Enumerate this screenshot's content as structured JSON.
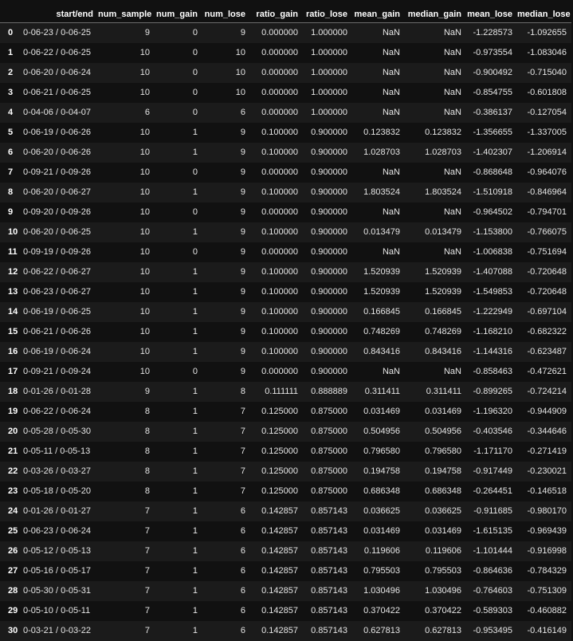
{
  "table": {
    "columns": [
      "",
      "start/end",
      "num_sample",
      "num_gain",
      "num_lose",
      "ratio_gain",
      "ratio_lose",
      "mean_gain",
      "median_gain",
      "mean_lose",
      "median_lose"
    ],
    "rows": [
      [
        "0",
        "0-06-23 / 0-06-25",
        "9",
        "0",
        "9",
        "0.000000",
        "1.000000",
        "NaN",
        "NaN",
        "-1.228573",
        "-1.092655"
      ],
      [
        "1",
        "0-06-22 / 0-06-25",
        "10",
        "0",
        "10",
        "0.000000",
        "1.000000",
        "NaN",
        "NaN",
        "-0.973554",
        "-1.083046"
      ],
      [
        "2",
        "0-06-20 / 0-06-24",
        "10",
        "0",
        "10",
        "0.000000",
        "1.000000",
        "NaN",
        "NaN",
        "-0.900492",
        "-0.715040"
      ],
      [
        "3",
        "0-06-21 / 0-06-25",
        "10",
        "0",
        "10",
        "0.000000",
        "1.000000",
        "NaN",
        "NaN",
        "-0.854755",
        "-0.601808"
      ],
      [
        "4",
        "0-04-06 / 0-04-07",
        "6",
        "0",
        "6",
        "0.000000",
        "1.000000",
        "NaN",
        "NaN",
        "-0.386137",
        "-0.127054"
      ],
      [
        "5",
        "0-06-19 / 0-06-26",
        "10",
        "1",
        "9",
        "0.100000",
        "0.900000",
        "0.123832",
        "0.123832",
        "-1.356655",
        "-1.337005"
      ],
      [
        "6",
        "0-06-20 / 0-06-26",
        "10",
        "1",
        "9",
        "0.100000",
        "0.900000",
        "1.028703",
        "1.028703",
        "-1.402307",
        "-1.206914"
      ],
      [
        "7",
        "0-09-21 / 0-09-26",
        "10",
        "0",
        "9",
        "0.000000",
        "0.900000",
        "NaN",
        "NaN",
        "-0.868648",
        "-0.964076"
      ],
      [
        "8",
        "0-06-20 / 0-06-27",
        "10",
        "1",
        "9",
        "0.100000",
        "0.900000",
        "1.803524",
        "1.803524",
        "-1.510918",
        "-0.846964"
      ],
      [
        "9",
        "0-09-20 / 0-09-26",
        "10",
        "0",
        "9",
        "0.000000",
        "0.900000",
        "NaN",
        "NaN",
        "-0.964502",
        "-0.794701"
      ],
      [
        "10",
        "0-06-20 / 0-06-25",
        "10",
        "1",
        "9",
        "0.100000",
        "0.900000",
        "0.013479",
        "0.013479",
        "-1.153800",
        "-0.766075"
      ],
      [
        "11",
        "0-09-19 / 0-09-26",
        "10",
        "0",
        "9",
        "0.000000",
        "0.900000",
        "NaN",
        "NaN",
        "-1.006838",
        "-0.751694"
      ],
      [
        "12",
        "0-06-22 / 0-06-27",
        "10",
        "1",
        "9",
        "0.100000",
        "0.900000",
        "1.520939",
        "1.520939",
        "-1.407088",
        "-0.720648"
      ],
      [
        "13",
        "0-06-23 / 0-06-27",
        "10",
        "1",
        "9",
        "0.100000",
        "0.900000",
        "1.520939",
        "1.520939",
        "-1.549853",
        "-0.720648"
      ],
      [
        "14",
        "0-06-19 / 0-06-25",
        "10",
        "1",
        "9",
        "0.100000",
        "0.900000",
        "0.166845",
        "0.166845",
        "-1.222949",
        "-0.697104"
      ],
      [
        "15",
        "0-06-21 / 0-06-26",
        "10",
        "1",
        "9",
        "0.100000",
        "0.900000",
        "0.748269",
        "0.748269",
        "-1.168210",
        "-0.682322"
      ],
      [
        "16",
        "0-06-19 / 0-06-24",
        "10",
        "1",
        "9",
        "0.100000",
        "0.900000",
        "0.843416",
        "0.843416",
        "-1.144316",
        "-0.623487"
      ],
      [
        "17",
        "0-09-21 / 0-09-24",
        "10",
        "0",
        "9",
        "0.000000",
        "0.900000",
        "NaN",
        "NaN",
        "-0.858463",
        "-0.472621"
      ],
      [
        "18",
        "0-01-26 / 0-01-28",
        "9",
        "1",
        "8",
        "0.111111",
        "0.888889",
        "0.311411",
        "0.311411",
        "-0.899265",
        "-0.724214"
      ],
      [
        "19",
        "0-06-22 / 0-06-24",
        "8",
        "1",
        "7",
        "0.125000",
        "0.875000",
        "0.031469",
        "0.031469",
        "-1.196320",
        "-0.944909"
      ],
      [
        "20",
        "0-05-28 / 0-05-30",
        "8",
        "1",
        "7",
        "0.125000",
        "0.875000",
        "0.504956",
        "0.504956",
        "-0.403546",
        "-0.344646"
      ],
      [
        "21",
        "0-05-11 / 0-05-13",
        "8",
        "1",
        "7",
        "0.125000",
        "0.875000",
        "0.796580",
        "0.796580",
        "-1.171170",
        "-0.271419"
      ],
      [
        "22",
        "0-03-26 / 0-03-27",
        "8",
        "1",
        "7",
        "0.125000",
        "0.875000",
        "0.194758",
        "0.194758",
        "-0.917449",
        "-0.230021"
      ],
      [
        "23",
        "0-05-18 / 0-05-20",
        "8",
        "1",
        "7",
        "0.125000",
        "0.875000",
        "0.686348",
        "0.686348",
        "-0.264451",
        "-0.146518"
      ],
      [
        "24",
        "0-01-26 / 0-01-27",
        "7",
        "1",
        "6",
        "0.142857",
        "0.857143",
        "0.036625",
        "0.036625",
        "-0.911685",
        "-0.980170"
      ],
      [
        "25",
        "0-06-23 / 0-06-24",
        "7",
        "1",
        "6",
        "0.142857",
        "0.857143",
        "0.031469",
        "0.031469",
        "-1.615135",
        "-0.969439"
      ],
      [
        "26",
        "0-05-12 / 0-05-13",
        "7",
        "1",
        "6",
        "0.142857",
        "0.857143",
        "0.119606",
        "0.119606",
        "-1.101444",
        "-0.916998"
      ],
      [
        "27",
        "0-05-16 / 0-05-17",
        "7",
        "1",
        "6",
        "0.142857",
        "0.857143",
        "0.795503",
        "0.795503",
        "-0.864636",
        "-0.784329"
      ],
      [
        "28",
        "0-05-30 / 0-05-31",
        "7",
        "1",
        "6",
        "0.142857",
        "0.857143",
        "1.030496",
        "1.030496",
        "-0.764603",
        "-0.751309"
      ],
      [
        "29",
        "0-05-10 / 0-05-11",
        "7",
        "1",
        "6",
        "0.142857",
        "0.857143",
        "0.370422",
        "0.370422",
        "-0.589303",
        "-0.460882"
      ],
      [
        "30",
        "0-03-21 / 0-03-22",
        "7",
        "1",
        "6",
        "0.142857",
        "0.857143",
        "0.627813",
        "0.627813",
        "-0.953495",
        "-0.416149"
      ]
    ]
  }
}
